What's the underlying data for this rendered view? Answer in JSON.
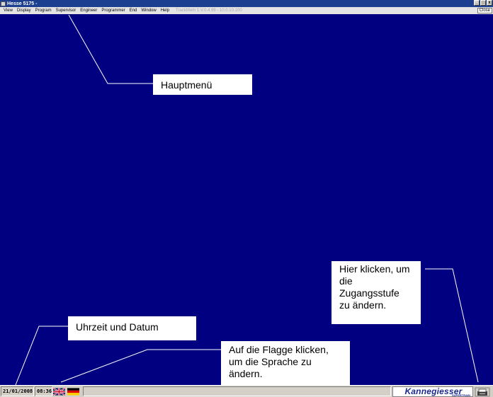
{
  "window": {
    "title": "Hesse 5175 -",
    "controls": [
      "_",
      "□",
      "x"
    ]
  },
  "menu": {
    "items": [
      "View",
      "Display",
      "Program",
      "Supervisor",
      "Engineer",
      "Programmer",
      "End",
      "Window",
      "Help"
    ],
    "info": "TrackMem 1.V.0.4.99 - 10.0.10.100",
    "close_label": "Close"
  },
  "callouts": {
    "main_menu": "Hauptmenü",
    "clock": "Uhrzeit und Datum",
    "flag_lines": [
      "Auf die Flagge klicken,",
      "um die Sprache zu",
      "ändern."
    ],
    "access_lines": [
      "Hier klicken, um",
      "die",
      "Zugangsstufe",
      "zu ändern."
    ]
  },
  "statusbar": {
    "date": "21/01/2008",
    "time": "08:36",
    "languages": [
      "english-flag",
      "german-flag"
    ],
    "brand": "Kannegiesser",
    "brand_sub": "SUPERTRAIN"
  },
  "colors": {
    "background": "#000080",
    "titlebar": "#1c3f8f",
    "menubar": "#e4e4e4",
    "statusbar": "#d4d0c8",
    "brand": "#1a2a8c"
  }
}
